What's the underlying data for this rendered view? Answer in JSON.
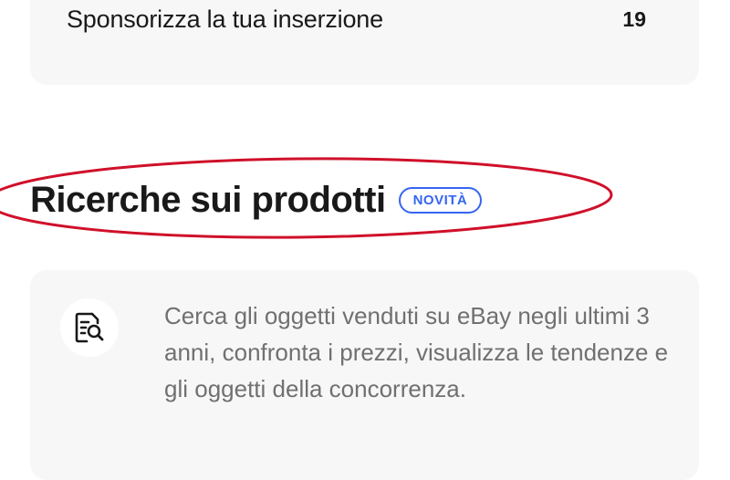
{
  "sponsor_card": {
    "label": "Sponsorizza la tua inserzione",
    "count": "19"
  },
  "research_section": {
    "title": "Ricerche sui prodotti",
    "badge": "NOVITÀ",
    "badge_color": "#3665f3",
    "annotation_color": "#d0102a",
    "description": "Cerca gli oggetti venduti su eBay negli ultimi 3 anni, confronta i prezzi, visualizza le tendenze e gli oggetti della concorrenza.",
    "icon": "document-search-icon"
  }
}
